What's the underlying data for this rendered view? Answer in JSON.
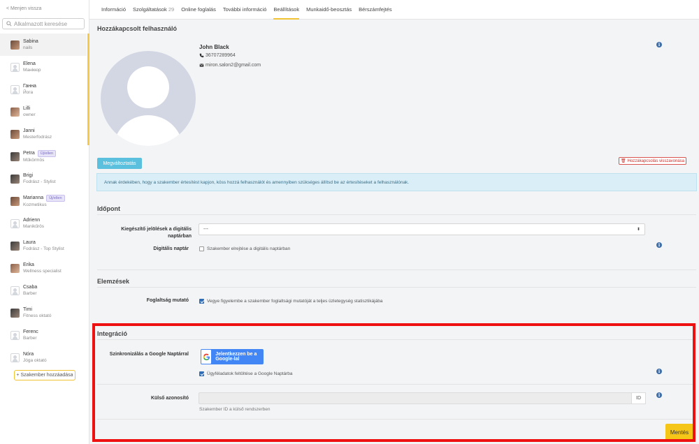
{
  "sidebar": {
    "back_label": "< Menjen vissza",
    "search_placeholder": "Alkalmazott keresése",
    "staff": [
      {
        "name": "Sabina",
        "role": "nails",
        "badge": ""
      },
      {
        "name": "Elena",
        "role": "Манікюр",
        "badge": ""
      },
      {
        "name": "Ганна",
        "role": "Йога",
        "badge": ""
      },
      {
        "name": "Lilli",
        "role": "owner",
        "badge": ""
      },
      {
        "name": "Janni",
        "role": "Mesterfodrász",
        "badge": ""
      },
      {
        "name": "Petra",
        "role": "Műkörmös",
        "badge": "Új/ellen"
      },
      {
        "name": "Brigi",
        "role": "Fodrász - Stylist",
        "badge": ""
      },
      {
        "name": "Marianna",
        "role": "Kozmetikus",
        "badge": "Új/ellen"
      },
      {
        "name": "Adrienn",
        "role": "Manikűrös",
        "badge": ""
      },
      {
        "name": "Laura",
        "role": "Fodrász - Top Stylist",
        "badge": ""
      },
      {
        "name": "Erika",
        "role": "Wellness specialist",
        "badge": ""
      },
      {
        "name": "Csaba",
        "role": "Barber",
        "badge": ""
      },
      {
        "name": "Timi",
        "role": "Fitness oktató",
        "badge": ""
      },
      {
        "name": "Ferenc",
        "role": "Barber",
        "badge": ""
      },
      {
        "name": "Nóra",
        "role": "Jóga oktató",
        "badge": ""
      }
    ],
    "add_label": "+ Szakember hozzáadása"
  },
  "tabs": [
    {
      "label": "Információ",
      "count": ""
    },
    {
      "label": "Szolgáltatások",
      "count": "29"
    },
    {
      "label": "Online foglalás",
      "count": ""
    },
    {
      "label": "További információ",
      "count": ""
    },
    {
      "label": "Beállítások",
      "count": ""
    },
    {
      "label": "Munkaidő-beosztás",
      "count": ""
    },
    {
      "label": "Bérszámfejtés",
      "count": ""
    }
  ],
  "linked_user": {
    "title": "Hozzákapcsolt felhasználó",
    "name": "John Black",
    "phone": "36707289964",
    "email": "miron.salon2@gmail.com",
    "change_label": "Megváltoztatás",
    "unlink_label": "Hozzákapcsolás visszavonása",
    "alert": "Annak érdekében, hogy a szakember értesítést kapjon, köss hozzá felhasználót és amennyiben szükséges állítsd be az értesítéseket a felhasználónak."
  },
  "appointment": {
    "title": "Időpont",
    "extra_label": "Kiegészítő jelölések a digitális naptárban",
    "extra_value": "---",
    "calendar_label": "Digitális naptár",
    "calendar_check": "Szakember elrejtése a digitális naptárban"
  },
  "elements": {
    "title": "Elemzések",
    "occupancy_label": "Foglaltság mutató",
    "occupancy_check": "Vegye figyelembe a szakember foglaltsági mutatóját a teljes üzletegység statisztikájába"
  },
  "integration": {
    "title": "Integráció",
    "google_label": "Szinkronizálás a Google Naptárral",
    "google_button": "Jelentkezzen be a Google-lal",
    "google_check": "Ügyféladatok feltöltése a Google Naptárba",
    "external_label": "Külső azonosító",
    "external_suffix": "ID",
    "external_hint": "Szakember ID a külső rendszerben"
  },
  "save_label": "Mentés",
  "colors": {
    "accent": "#f1c232",
    "primary": "#2f6db5",
    "highlight": "#ee1111"
  }
}
